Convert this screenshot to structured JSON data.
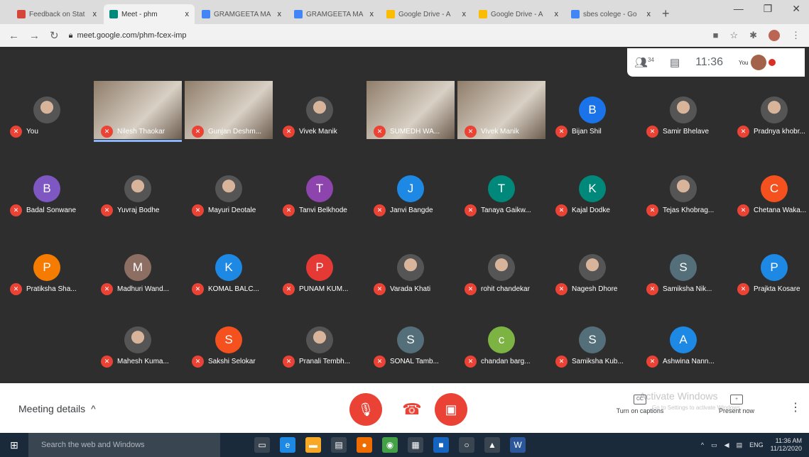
{
  "browser": {
    "tabs": [
      {
        "label": "Feedback on Stat",
        "color": "#d44638",
        "active": false
      },
      {
        "label": "Meet - phm",
        "color": "#00897b",
        "active": true
      },
      {
        "label": "GRAMGEETA MA",
        "color": "#4285f4",
        "active": false
      },
      {
        "label": "GRAMGEETA MA",
        "color": "#4285f4",
        "active": false
      },
      {
        "label": "Google Drive - A",
        "color": "#fbbc04",
        "active": false
      },
      {
        "label": "Google Drive - A",
        "color": "#fbbc04",
        "active": false
      },
      {
        "label": "sbes colege - Go",
        "color": "#4285f4",
        "active": false
      }
    ],
    "new_tab": "+",
    "close_glyph": "x",
    "url": "meet.google.com/phm-fcex-imp"
  },
  "meet": {
    "participant_count": "34",
    "time": "11:36",
    "self_label": "You",
    "tiles": [
      {
        "name": "You",
        "kind": "photo"
      },
      {
        "name": "Nilesh Thaokar",
        "kind": "video",
        "active": true
      },
      {
        "name": "Gunjan Deshm...",
        "kind": "video"
      },
      {
        "name": "Vivek Manik",
        "kind": "photo"
      },
      {
        "name": "SUMEDH WA...",
        "kind": "video"
      },
      {
        "name": "Vivek Manik",
        "kind": "video"
      },
      {
        "name": "Bijan Shil",
        "kind": "letter",
        "letter": "B",
        "color": "#1a73e8"
      },
      {
        "name": "Samir Bhelave",
        "kind": "photo"
      },
      {
        "name": "Pradnya khobr...",
        "kind": "photo"
      },
      {
        "name": "Badal Sonwane",
        "kind": "letter",
        "letter": "B",
        "color": "#7e57c2"
      },
      {
        "name": "Yuvraj Bodhe",
        "kind": "photo"
      },
      {
        "name": "Mayuri Deotale",
        "kind": "photo"
      },
      {
        "name": "Tanvi Belkhode",
        "kind": "letter",
        "letter": "T",
        "color": "#8e44ad"
      },
      {
        "name": "Janvi Bangde",
        "kind": "letter",
        "letter": "J",
        "color": "#1e88e5"
      },
      {
        "name": "Tanaya Gaikw...",
        "kind": "letter",
        "letter": "T",
        "color": "#00897b"
      },
      {
        "name": "Kajal Dodke",
        "kind": "letter",
        "letter": "K",
        "color": "#00897b"
      },
      {
        "name": "Tejas Khobrag...",
        "kind": "photo"
      },
      {
        "name": "Chetana Waka...",
        "kind": "letter",
        "letter": "C",
        "color": "#f4511e"
      },
      {
        "name": "Pratiksha Sha...",
        "kind": "letter",
        "letter": "P",
        "color": "#f57c00"
      },
      {
        "name": "Madhuri Wand...",
        "kind": "letter",
        "letter": "M",
        "color": "#8d6e63"
      },
      {
        "name": "KOMAL BALC...",
        "kind": "letter",
        "letter": "K",
        "color": "#1e88e5"
      },
      {
        "name": "PUNAM KUM...",
        "kind": "letter",
        "letter": "P",
        "color": "#e53935"
      },
      {
        "name": "Varada Khati",
        "kind": "photo"
      },
      {
        "name": "rohit chandekar",
        "kind": "photo"
      },
      {
        "name": "Nagesh Dhore",
        "kind": "photo"
      },
      {
        "name": "Samiksha Nik...",
        "kind": "letter",
        "letter": "S",
        "color": "#546e7a"
      },
      {
        "name": "Prajkta Kosare",
        "kind": "letter",
        "letter": "P",
        "color": "#1e88e5"
      },
      {
        "name": "Mahesh Kuma...",
        "kind": "photo"
      },
      {
        "name": "Sakshi Selokar",
        "kind": "letter",
        "letter": "S",
        "color": "#f4511e"
      },
      {
        "name": "Pranali Tembh...",
        "kind": "photo"
      },
      {
        "name": "SONAL Tamb...",
        "kind": "letter",
        "letter": "S",
        "color": "#546e7a"
      },
      {
        "name": "chandan barg...",
        "kind": "letter",
        "letter": "c",
        "color": "#7cb342"
      },
      {
        "name": "Samiksha Kub...",
        "kind": "letter",
        "letter": "S",
        "color": "#546e7a"
      },
      {
        "name": "Ashwina Nann...",
        "kind": "letter",
        "letter": "A",
        "color": "#1e88e5"
      }
    ]
  },
  "bottombar": {
    "meeting_details": "Meeting details",
    "captions": "Turn on captions",
    "captions_icon": "CC",
    "present": "Present now",
    "watermark_title": "Activate Windows",
    "watermark_sub": "Go to Settings to activate Windows.",
    "mic_color": "#ea4335",
    "hangup_color": "#ffffff"
  },
  "taskbar": {
    "search": "Search the web and Windows",
    "lang": "ENG",
    "time": "11:36 AM",
    "date": "11/12/2020"
  }
}
